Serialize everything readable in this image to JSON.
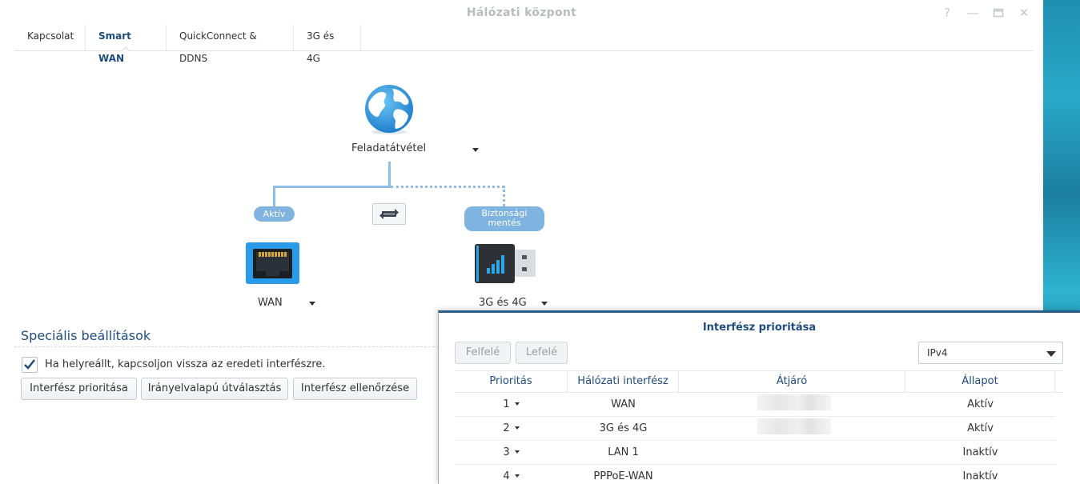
{
  "window": {
    "title": "Hálózati központ",
    "controls": [
      "help-icon",
      "minimize-icon",
      "maximize-icon",
      "close-icon"
    ]
  },
  "tabs": [
    {
      "label": "Kapcsolat",
      "active": false
    },
    {
      "label": "Smart WAN",
      "active": true
    },
    {
      "label": "QuickConnect & DDNS",
      "active": false
    },
    {
      "label": "3G és 4G",
      "active": false
    }
  ],
  "diagram": {
    "mode_label": "Feladatátvétel",
    "primary_status": "Aktív",
    "backup_status": "Biztonsági mentés",
    "swap_icon": "swap-arrows-icon",
    "primary_interface": "WAN",
    "backup_interface": "3G és 4G"
  },
  "special": {
    "title": "Speciális beállítások",
    "checkbox_label": "Ha helyreállt, kapcsoljon vissza az eredeti interfészre.",
    "checkbox_checked": true,
    "buttons": [
      "Interfész prioritása",
      "Irányelvalapú útválasztás",
      "Interfész ellenőrzése"
    ]
  },
  "dialog": {
    "title": "Interfész prioritása",
    "up_label": "Felfelé",
    "down_label": "Lefelé",
    "ip_version": "IPv4",
    "columns": [
      "Prioritás",
      "Hálózati interfész",
      "Átjáró",
      "Állapot"
    ],
    "rows": [
      {
        "priority": "1",
        "interface": "WAN",
        "gateway_hidden": true,
        "status": "Aktív"
      },
      {
        "priority": "2",
        "interface": "3G és 4G",
        "gateway_hidden": true,
        "status": "Aktív"
      },
      {
        "priority": "3",
        "interface": "LAN 1",
        "gateway_hidden": false,
        "status": "Inaktív"
      },
      {
        "priority": "4",
        "interface": "PPPoE-WAN",
        "gateway_hidden": false,
        "status": "Inaktív"
      }
    ]
  },
  "colors": {
    "accent": "#1f4c7e",
    "pill": "#7fb3e0",
    "line": "#8fbde6",
    "dialog_border": "#2a5c8a"
  }
}
